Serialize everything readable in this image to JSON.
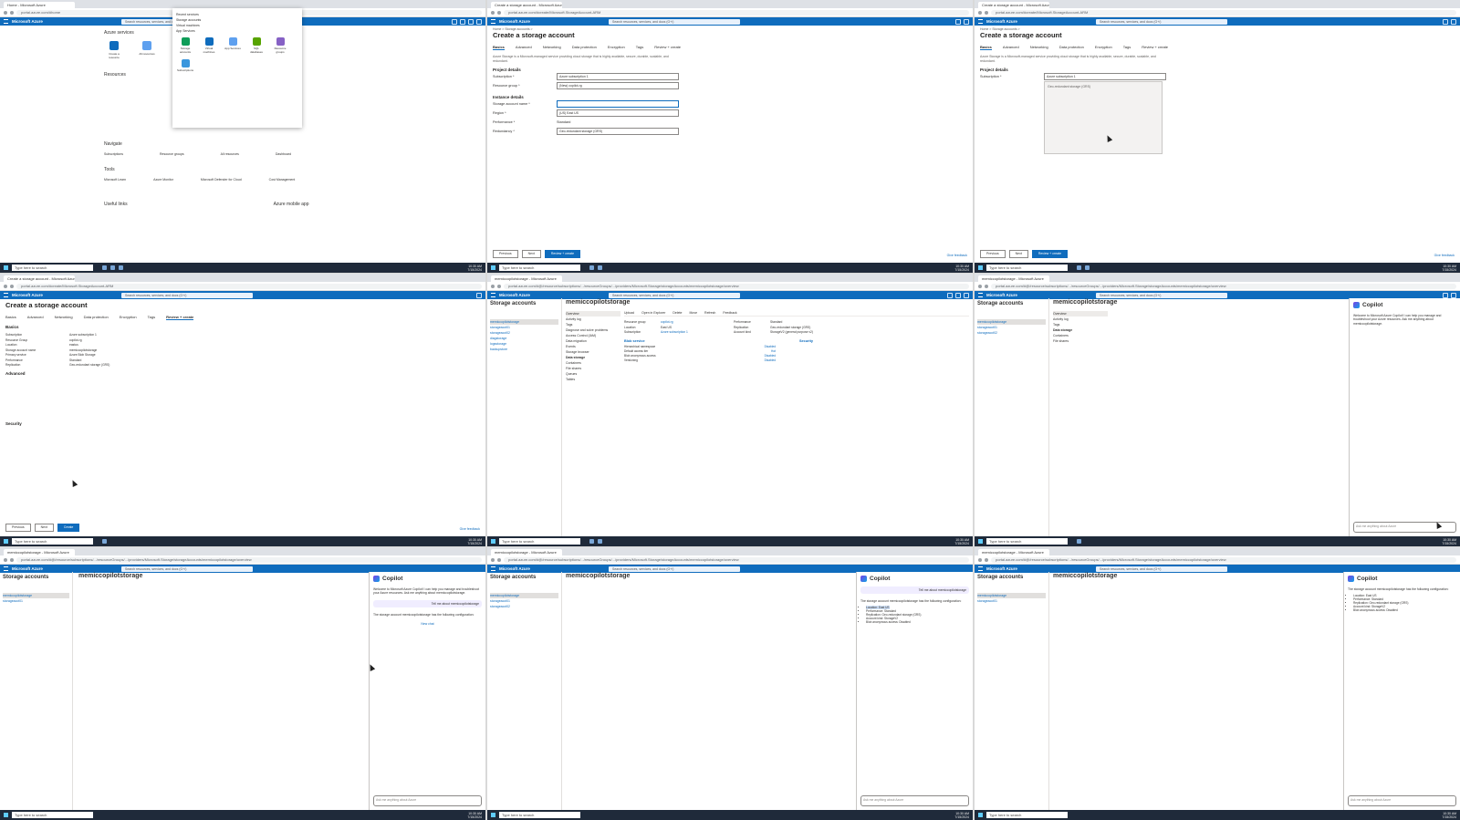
{
  "browser": {
    "tab_home": "Home - Microsoft Azure",
    "tab_create": "Create a storage account - Microsoft Azure",
    "tab_resource": "memiccopilotstorage - Microsoft Azure",
    "url_home": "portal.azure.com/#home",
    "url_create": "portal.azure.com/#create/Microsoft.StorageAccount-ARM",
    "url_resource": "portal.azure.com/#@/resource/subscriptions/.../resourceGroups/.../providers/Microsoft.Storage/storageAccounts/memiccopilotstorage/overview"
  },
  "azure": {
    "brand": "Microsoft Azure",
    "search_placeholder": "Search resources, services, and docs (G+/)"
  },
  "taskbar": {
    "search": "Type here to search",
    "time": "10:30 AM",
    "date": "7/15/2024"
  },
  "home": {
    "services_title": "Azure services",
    "services": [
      "Create a resource",
      "All resources",
      "Resource groups",
      "Storage accounts",
      "More services"
    ],
    "resources_title": "Resources",
    "navigate_title": "Navigate",
    "navigate": [
      "Subscriptions",
      "Resource groups",
      "All resources",
      "Dashboard"
    ],
    "tools_title": "Tools",
    "tools": [
      "Microsoft Learn",
      "Azure Monitor",
      "Microsoft Defender for Cloud",
      "Cost Management"
    ],
    "useful_title": "Useful links",
    "mobile_title": "Azure mobile app",
    "dropdown_items": [
      "Recent services",
      "Storage accounts",
      "Virtual machines",
      "App Services"
    ],
    "dropdown_grid": [
      "Storage accounts",
      "Virtual machines",
      "App Services",
      "SQL databases",
      "Resource groups",
      "Subscriptions",
      "Monitor",
      "Azure AD"
    ]
  },
  "create": {
    "breadcrumb": "Home > Storage accounts >",
    "title": "Create a storage account",
    "tabs": [
      "Basics",
      "Advanced",
      "Networking",
      "Data protection",
      "Encryption",
      "Tags",
      "Review + create"
    ],
    "intro": "Azure Storage is a Microsoft-managed service providing cloud storage that is highly available, secure, durable, scalable, and redundant.",
    "project_details": "Project details",
    "instance_details": "Instance details",
    "fields": [
      {
        "label": "Subscription *",
        "value": "Azure subscription 1"
      },
      {
        "label": "Resource group *",
        "value": "(New) copilot-rg"
      },
      {
        "label": "Storage account name *",
        "value": ""
      },
      {
        "label": "Region *",
        "value": "(US) East US"
      },
      {
        "label": "Performance *",
        "value": "Standard"
      },
      {
        "label": "Redundancy *",
        "value": "Geo-redundant storage (GRS)"
      }
    ],
    "btn_previous": "Previous",
    "btn_next": "Next",
    "btn_review": "Review + create",
    "btn_create": "Create",
    "feedback": "Give feedback",
    "review_sections": [
      "Basics",
      "Advanced",
      "Security"
    ],
    "review_rows": [
      {
        "k": "Subscription",
        "v": "Azure subscription 1"
      },
      {
        "k": "Resource Group",
        "v": "copilot-rg"
      },
      {
        "k": "Location",
        "v": "eastus"
      },
      {
        "k": "Storage account name",
        "v": "memiccopilotstorage"
      },
      {
        "k": "Primary service",
        "v": "Azure Blob Storage"
      },
      {
        "k": "Performance",
        "v": "Standard"
      },
      {
        "k": "Replication",
        "v": "Geo-redundant storage (GRS)"
      }
    ]
  },
  "resource": {
    "list_title": "Storage accounts",
    "list_items": [
      "memiccopilotstorage",
      "storageacct01",
      "storageacct02",
      "diagstorage",
      "logsstorage",
      "backupstore"
    ],
    "name": "memiccopilotstorage",
    "subtitle": "Storage account",
    "commands": [
      "Upload",
      "Open in Explorer",
      "Delete",
      "Move",
      "Refresh",
      "Feedback"
    ],
    "nav": [
      "Overview",
      "Activity log",
      "Tags",
      "Diagnose and solve problems",
      "Access Control (IAM)",
      "Data migration",
      "Events",
      "Storage browser"
    ],
    "nav_header": "Data storage",
    "nav2": [
      "Containers",
      "File shares",
      "Queues",
      "Tables"
    ],
    "essentials": [
      {
        "k": "Resource group",
        "v": "copilot-rg"
      },
      {
        "k": "Performance",
        "v": "Standard"
      },
      {
        "k": "Location",
        "v": "East US"
      },
      {
        "k": "Replication",
        "v": "Geo-redundant storage (GRS)"
      },
      {
        "k": "Subscription",
        "v": "Azure subscription 1"
      },
      {
        "k": "Account kind",
        "v": "StorageV2 (general purpose v2)"
      }
    ],
    "props_blob": "Blob service",
    "props_security": "Security",
    "props_rows": [
      {
        "k": "Hierarchical namespace",
        "v": "Disabled"
      },
      {
        "k": "Default access tier",
        "v": "Hot"
      },
      {
        "k": "Blob anonymous access",
        "v": "Disabled"
      },
      {
        "k": "Versioning",
        "v": "Disabled"
      }
    ]
  },
  "copilot": {
    "title": "Copilot",
    "welcome": "Welcome to Microsoft Azure Copilot! I can help you manage and troubleshoot your Azure resources. Ask me anything about memiccopilotstorage.",
    "user_msg": "Tell me about memiccopilotstorage",
    "answer_intro": "The storage account memiccopilotstorage has the following configuration:",
    "answer_items": [
      "Location: East US",
      "Performance: Standard",
      "Replication: Geo-redundant storage (GRS)",
      "Account kind: StorageV2",
      "Blob anonymous access: Disabled"
    ],
    "input_placeholder": "Ask me anything about Azure",
    "new_chat": "New chat"
  }
}
